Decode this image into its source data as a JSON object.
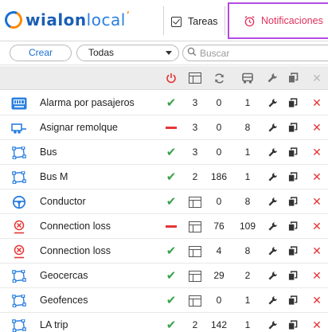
{
  "header": {
    "logo_text_bold": "wialon",
    "logo_text_light": "local",
    "nav": [
      {
        "label": "Tareas",
        "icon": "task-checkbox-icon",
        "active": false
      },
      {
        "label": "Notificaciones",
        "icon": "alarm-clock-icon",
        "active": true
      }
    ],
    "active_outline_color": "#b44be1",
    "active_text_color": "#e0315b"
  },
  "filters": {
    "create_label": "Crear",
    "type_select_value": "Todas",
    "search_placeholder": "Buscar"
  },
  "table": {
    "header_icons": [
      "power-icon",
      "schedule-icon",
      "refresh-icon",
      "vehicle-icon",
      "wrench-icon",
      "copy-icon",
      "delete-icon"
    ],
    "rows": [
      {
        "name": "Alarma por pasajeros",
        "icon": "passenger-counter-icon",
        "enabled": true,
        "schedule": false,
        "count": "3",
        "triggers": "0",
        "units": "1"
      },
      {
        "name": "Asignar remolque",
        "icon": "trailer-icon",
        "enabled": false,
        "schedule": false,
        "count": "3",
        "triggers": "0",
        "units": "8"
      },
      {
        "name": "Bus",
        "icon": "geofence-icon",
        "enabled": true,
        "schedule": false,
        "count": "3",
        "triggers": "0",
        "units": "1"
      },
      {
        "name": "Bus M",
        "icon": "geofence-icon",
        "enabled": true,
        "schedule": false,
        "count": "2",
        "triggers": "186",
        "units": "1"
      },
      {
        "name": "Conductor",
        "icon": "steering-wheel-icon",
        "enabled": true,
        "schedule": true,
        "count": "",
        "triggers": "0",
        "units": "8"
      },
      {
        "name": "Connection loss",
        "icon": "connection-loss-icon",
        "enabled": false,
        "schedule": true,
        "count": "",
        "triggers": "76",
        "units": "109"
      },
      {
        "name": "Connection loss",
        "icon": "connection-loss-icon",
        "enabled": true,
        "schedule": true,
        "count": "",
        "triggers": "4",
        "units": "8"
      },
      {
        "name": "Geocercas",
        "icon": "geofence-icon",
        "enabled": true,
        "schedule": true,
        "count": "",
        "triggers": "29",
        "units": "2"
      },
      {
        "name": "Geofences",
        "icon": "geofence-icon",
        "enabled": true,
        "schedule": true,
        "count": "",
        "triggers": "0",
        "units": "1"
      },
      {
        "name": "LA trip",
        "icon": "geofence-icon",
        "enabled": true,
        "schedule": false,
        "count": "2",
        "triggers": "142",
        "units": "1"
      }
    ]
  },
  "colors": {
    "brand_blue": "#1a6fd1",
    "enabled_green": "#3aa24c",
    "disabled_red": "#e53535"
  }
}
